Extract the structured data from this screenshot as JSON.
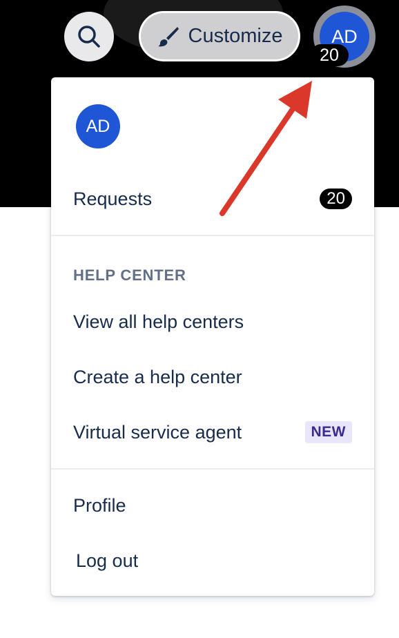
{
  "header": {
    "search_icon": "search-icon",
    "customize_label": "Customize",
    "customize_icon": "paintbrush-icon",
    "avatar_initials": "AD",
    "avatar_badge_count": "20",
    "colors": {
      "background": "#000000",
      "avatar": "#1f56d6"
    }
  },
  "menu": {
    "avatar_initials": "AD",
    "requests": {
      "label": "Requests",
      "count": "20"
    },
    "help_center": {
      "title": "HELP CENTER",
      "items": [
        {
          "label": "View all help centers"
        },
        {
          "label": "Create a help center"
        },
        {
          "label": "Virtual service agent",
          "badge": "NEW"
        }
      ]
    },
    "account": {
      "profile_label": "Profile",
      "logout_label": "Log out"
    },
    "colors": {
      "text": "#172b4d",
      "section_title": "#626f86",
      "new_badge_bg": "#e9e6fb"
    }
  },
  "annotation": {
    "arrow_color": "#d9382b"
  }
}
